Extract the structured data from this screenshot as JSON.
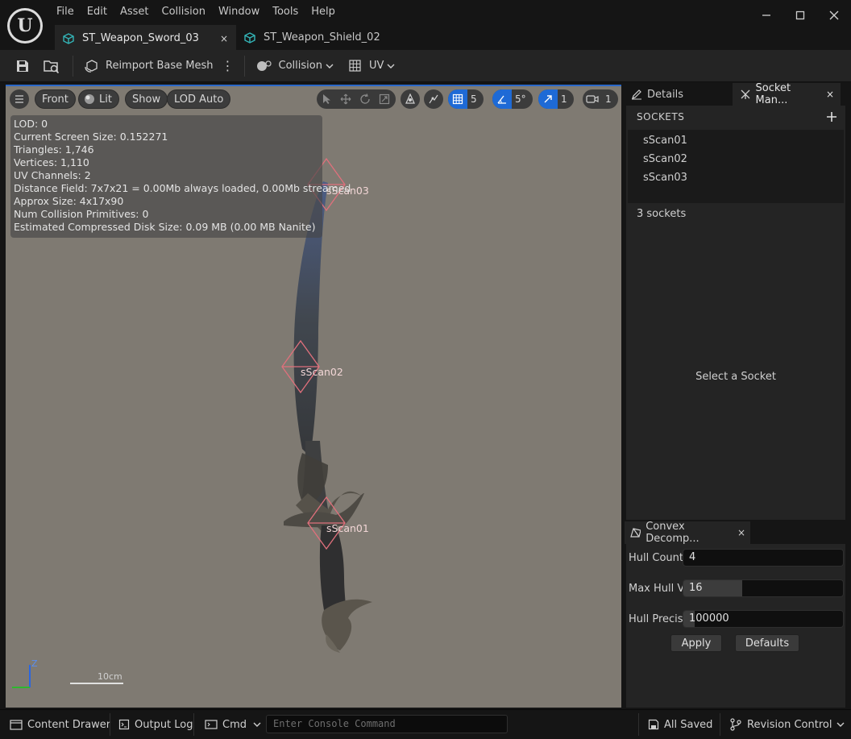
{
  "menu": [
    "File",
    "Edit",
    "Asset",
    "Collision",
    "Window",
    "Tools",
    "Help"
  ],
  "tabs": [
    {
      "label": "ST_Weapon_Sword_03",
      "active": true,
      "close": "×"
    },
    {
      "label": "ST_Weapon_Shield_02",
      "active": false
    }
  ],
  "toolbar": {
    "reimport_label": "Reimport Base Mesh",
    "collision_label": "Collision",
    "uv_label": "UV"
  },
  "viewport": {
    "view_mode": "Front",
    "lighting": "Lit",
    "show_label": "Show",
    "lod_label": "LOD Auto",
    "grid_snap_value": "5",
    "rotation_snap_value": "5°",
    "scale_snap_value": "1",
    "camera_speed_value": "1",
    "stats": [
      "LOD:  0",
      "Current Screen Size:  0.152271",
      "Triangles:  1,746",
      "Vertices:  1,110",
      "UV Channels:  2",
      "Distance Field:  7x7x21 = 0.00Mb always loaded, 0.00Mb streamed",
      "Approx Size:  4x17x90",
      "Num Collision Primitives:  0",
      "Estimated Compressed Disk Size: 0.09 MB (0.00 MB Nanite)"
    ],
    "sockets": [
      "sScan03",
      "sScan02",
      "sScan01"
    ],
    "axis_label": "Z",
    "scale_label": "10cm"
  },
  "right_panel": {
    "details_tab": "Details",
    "socket_tab": "Socket Man...",
    "sockets_header": "SOCKETS",
    "socket_list": [
      "sScan01",
      "sScan02",
      "sScan03"
    ],
    "socket_count": "3 sockets",
    "select_message": "Select a Socket",
    "convex_tab": "Convex Decomp...",
    "close_glyph": "×",
    "props": [
      {
        "label": "Hull Count",
        "value": "4",
        "fill": 0
      },
      {
        "label": "Max Hull Ve",
        "value": "16",
        "fill": 0.37
      },
      {
        "label": "Hull Precisi",
        "value": "100000",
        "fill": 0.07
      }
    ],
    "apply_label": "Apply",
    "defaults_label": "Defaults"
  },
  "statusbar": {
    "content_drawer": "Content Drawer",
    "output_log": "Output Log",
    "cmd": "Cmd",
    "console_placeholder": "Enter Console Command",
    "all_saved": "All Saved",
    "revision_control": "Revision Control"
  }
}
